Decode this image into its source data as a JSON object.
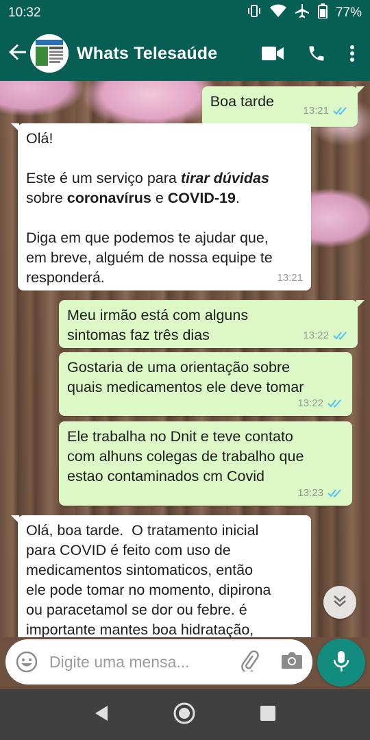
{
  "status_bar": {
    "time": "10:32",
    "battery": "77%",
    "icons": [
      "vibrate-icon",
      "wifi-icon",
      "airplane-icon",
      "battery-icon"
    ]
  },
  "header": {
    "title": "Whats Telesaúde",
    "icons": [
      "back-arrow-icon",
      "video-call-icon",
      "phone-icon",
      "more-vert-icon"
    ]
  },
  "messages": [
    {
      "direction": "out",
      "text": "Boa tarde",
      "time": "13:21",
      "read": true
    },
    {
      "direction": "in",
      "segments": [
        {
          "t": "Olá!\n\nEste é um serviço para "
        },
        {
          "t": "tirar dúvidas",
          "style": "bi"
        },
        {
          "t": "\nsobre "
        },
        {
          "t": "coronavírus",
          "style": "b"
        },
        {
          "t": " e "
        },
        {
          "t": "COVID-19",
          "style": "b"
        },
        {
          "t": ".\n\nDiga em que podemos te ajudar que,\nem breve, alguém de nossa equipe te\nresponderá."
        }
      ],
      "time": "13:21"
    },
    {
      "direction": "out",
      "text": "Meu irmão está com alguns\nsintomas faz três dias",
      "time": "13:22",
      "read": true
    },
    {
      "direction": "out",
      "text": "Gostaria de uma orientação sobre\nquais medicamentos ele deve tomar",
      "time": "13:22",
      "read": true
    },
    {
      "direction": "out",
      "text": "Ele trabalha no Dnit e teve contato\ncom alhuns colegas de trabalho que\nestao contaminados cm Covid",
      "time": "13:23",
      "read": true
    },
    {
      "direction": "in",
      "text": "Olá, boa tarde.  O tratamento inicial\npara COVID é feito com uso de\nmedicamentos sintomaticos, então\nele pode tomar no momento, dipirona\nou paracetamol se dor ou febre. é\nimportante mantes boa hidratação,",
      "time": ""
    }
  ],
  "composer": {
    "placeholder": "Digite uma mensa...",
    "icons": [
      "emoji-icon",
      "attach-icon",
      "camera-icon",
      "mic-icon"
    ]
  },
  "nav": {
    "icons": [
      "back-triangle-icon",
      "home-circle-icon",
      "recents-square-icon"
    ]
  },
  "colors": {
    "header": "#075e54",
    "outgoing_bubble": "#dcf8c6",
    "incoming_bubble": "#ffffff",
    "read_ticks": "#4fc3f7",
    "mic_button": "#128c7e"
  }
}
